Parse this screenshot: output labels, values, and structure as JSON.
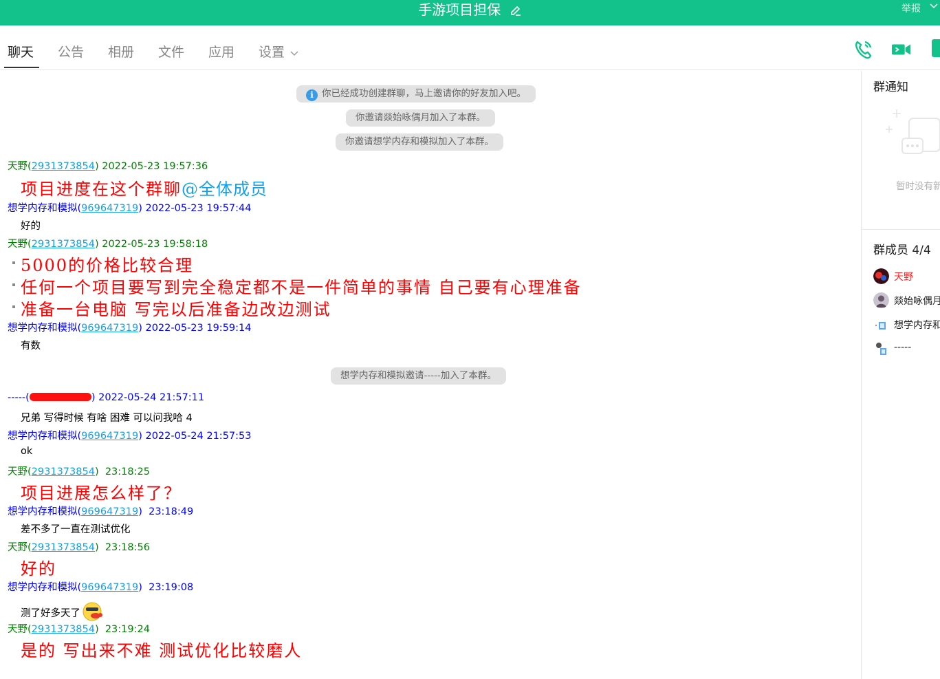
{
  "window": {
    "title": "手游项目担保",
    "report_label": "举报"
  },
  "tabs": [
    {
      "label": "聊天"
    },
    {
      "label": "公告"
    },
    {
      "label": "相册"
    },
    {
      "label": "文件"
    },
    {
      "label": "应用"
    },
    {
      "label": "设置"
    }
  ],
  "system_messages": [
    "你已经成功创建群聊，马上邀请你的好友加入吧。",
    "你邀请燚始咏偶月加入了本群。",
    "你邀请想学内存和模拟加入了本群。",
    "想学内存和模拟邀请-----加入了本群。"
  ],
  "messages": [
    {
      "sender": "天野",
      "qq": "2931373854",
      "time": "2022-05-23 19:57:36",
      "text": "项目进度在这个群聊",
      "mention": "@全体成员"
    },
    {
      "sender": "想学内存和模拟",
      "qq": "969647319",
      "time": "2022-05-23 19:57:44",
      "text": "好的"
    },
    {
      "sender": "天野",
      "qq": "2931373854",
      "time": "2022-05-23 19:58:18",
      "lines": [
        "5000的价格比较合理",
        "任何一个项目要写到完全稳定都不是一件简单的事情  自己要有心理准备",
        "准备一台电脑  写完以后准备边改边测试"
      ]
    },
    {
      "sender": "想学内存和模拟",
      "qq": "969647319",
      "time": "2022-05-23 19:59:14",
      "text": "有数"
    },
    {
      "sender": "-----",
      "qq_prefix": "(",
      "qq_suffix": ")",
      "time": "2022-05-24 21:57:11",
      "text": "兄弟  写得时候 有啥 困难 可以问我哈 4"
    },
    {
      "sender": "想学内存和模拟",
      "qq": "969647319",
      "time": "2022-05-24 21:57:53",
      "text": "ok"
    },
    {
      "sender": "天野",
      "qq": "2931373854",
      "time": "23:18:25",
      "text": "项目进展怎么样了？"
    },
    {
      "sender": "想学内存和模拟",
      "qq": "969647319",
      "time": "23:18:49",
      "text": "差不多了一直在测试优化"
    },
    {
      "sender": "天野",
      "qq": "2931373854",
      "time": "23:18:56",
      "text": "好的"
    },
    {
      "sender": "想学内存和模拟",
      "qq": "969647319",
      "time": "23:19:08",
      "text": "测了好多天了"
    },
    {
      "sender": "天野",
      "qq": "2931373854",
      "time": "23:19:24",
      "text": "是的  写出来不难  测试优化比较磨人"
    }
  ],
  "sidebar": {
    "notice_title": "群通知",
    "notice_empty": "暂时没有新",
    "members_title": "群成员 4/4",
    "members": [
      {
        "name": "天野",
        "owner": true
      },
      {
        "name": "燚始咏偶月"
      },
      {
        "name": "想学内存和模拟"
      },
      {
        "name": "-----"
      }
    ]
  },
  "colors": {
    "titlebar": "#12c28a",
    "accent_green": "#12c28a",
    "sender_green": "#008000",
    "sender_blue": "#0000ff",
    "big_text_red": "#ff0000",
    "link_blue": "#12a0e6"
  },
  "icons": {
    "edit": "edit-pencil-icon",
    "voice_call": "phone-icon",
    "video_call": "video-camera-icon",
    "chevron": "chevron-down-icon",
    "info": "info-icon"
  }
}
